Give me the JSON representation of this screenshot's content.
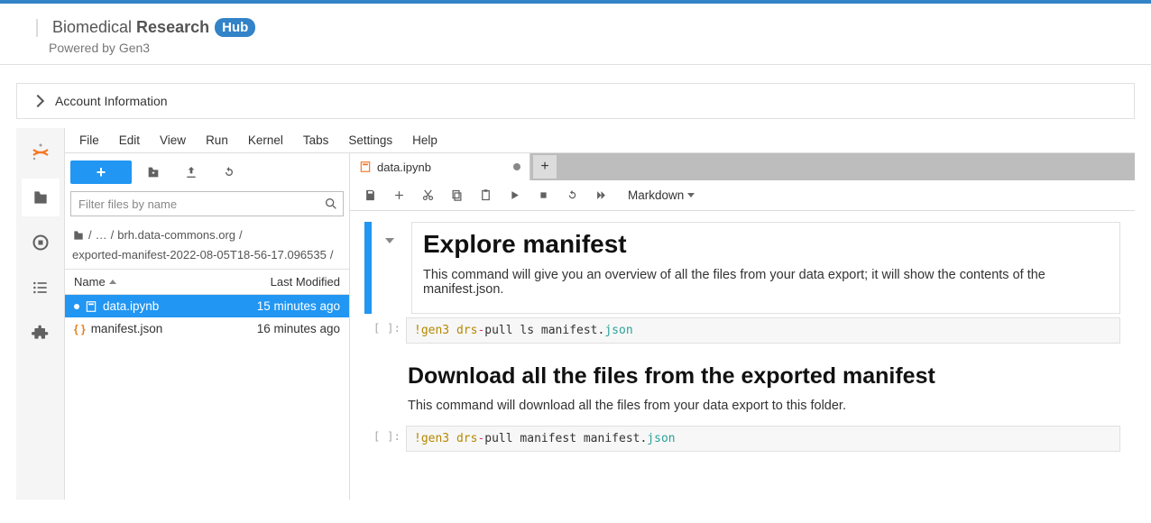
{
  "brand": {
    "text1": "Biomedical ",
    "text2": "Research",
    "badge": "Hub",
    "powered": "Powered by Gen3"
  },
  "account": {
    "label": "Account Information"
  },
  "menu": {
    "file": "File",
    "edit": "Edit",
    "view": "View",
    "run": "Run",
    "kernel": "Kernel",
    "tabs": "Tabs",
    "settings": "Settings",
    "help": "Help"
  },
  "filepanel": {
    "filter_placeholder": "Filter files by name",
    "crumb_seg1": "…",
    "crumb_seg2": "brh.data-commons.org",
    "crumb_seg3": "exported-manifest-2022-08-05T18-56-17.096535",
    "col_name": "Name",
    "col_modified": "Last Modified",
    "files": [
      {
        "name": "data.ipynb",
        "modified": "15 minutes ago"
      },
      {
        "name": "manifest.json",
        "modified": "16 minutes ago"
      }
    ]
  },
  "tab": {
    "title": "data.ipynb"
  },
  "nb_toolbar": {
    "celltype": "Markdown"
  },
  "notebook": {
    "h1": "Explore manifest",
    "p1": "This command will give you an overview of all the files from your data export; it will show the contents of the manifest.json.",
    "code1_pre": "!gen3 drs",
    "code1_op": "-",
    "code1_mid": "pull ls manifest.",
    "code1_ext": "json",
    "h2": "Download all the files from the exported manifest",
    "p2": "This command will download all the files from your data export to this folder.",
    "code2_pre": "!gen3  drs",
    "code2_op": "-",
    "code2_mid": "pull manifest manifest.",
    "code2_ext": "json",
    "prompt": "[ ]:"
  }
}
